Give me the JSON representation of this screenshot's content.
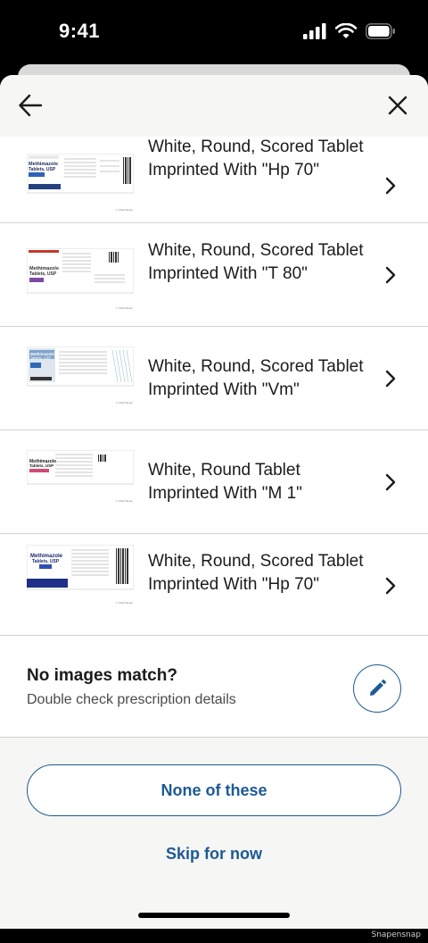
{
  "status": {
    "time": "9:41"
  },
  "results": [
    {
      "description": "White, Round, Scored Tablet Imprinted With \"Hp 70\"",
      "image": "methimazole-label-10mg"
    },
    {
      "description": "White, Round, Scored Tablet Imprinted With \"T 80\"",
      "image": "methimazole-label-10mg-b"
    },
    {
      "description": "White, Round, Scored Tablet Imprinted With \"Vm\"",
      "image": "methimazole-label-5mg"
    },
    {
      "description": "White, Round Tablet Imprinted With \"M 1\"",
      "image": "methimazole-label-5mg-b"
    },
    {
      "description": "White, Round, Scored Tablet Imprinted With \"Hp 70\"",
      "image": "methimazole-label-5mg-c"
    }
  ],
  "no_match": {
    "title": "No images match?",
    "subtitle": "Double check prescription details"
  },
  "footer": {
    "none_label": "None of these",
    "skip_label": "Skip for now"
  },
  "watermark": "Snapensnap",
  "colors": {
    "accent": "#1d5a94",
    "text": "#1b1b1b",
    "divider": "#d3d3d3",
    "sheet_bg": "#f6f6f4"
  },
  "icons": {
    "back": "arrow-left-icon",
    "close": "close-icon",
    "chevron": "chevron-right-icon",
    "edit": "pencil-icon"
  },
  "label_texts": {
    "r0": {
      "name": "Methimazole",
      "sub": "Tablets, USP",
      "strength": "5 mg"
    },
    "r1": {
      "name": "Methimazole",
      "sub": "Tablets, USP",
      "strength": "10 mg"
    },
    "r2": {
      "name": "Methimazole",
      "sub": "Tablets, USP",
      "strength": "5 mg"
    },
    "r3": {
      "name": "Methimazole",
      "sub": "Tablets, USP",
      "strength": "5 mg"
    },
    "r4": {
      "name": "Methimazole",
      "sub": "Tablets, USP",
      "strength": "5 mg"
    }
  }
}
